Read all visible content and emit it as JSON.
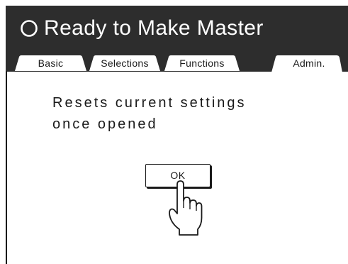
{
  "header": {
    "status_text": "Ready to Make Master",
    "status_icon": "ring-status-icon",
    "background_color": "#2d2d2d"
  },
  "tabs": [
    {
      "label": "Basic",
      "active": false
    },
    {
      "label": "Selections",
      "active": false
    },
    {
      "label": "Functions",
      "active": false
    },
    {
      "label": "Admin.",
      "active": true
    }
  ],
  "content": {
    "message_line1": "Resets current settings",
    "message_line2": "once opened",
    "ok_label": "OK",
    "pointer_icon": "pointing-hand-icon"
  }
}
